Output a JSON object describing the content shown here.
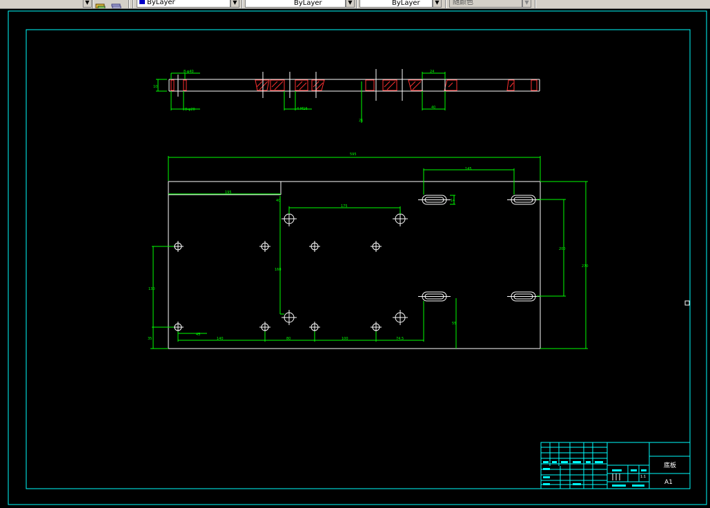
{
  "toolbar": {
    "layer_combo_1": "ByLayer",
    "layer_combo_2": "ByLayer",
    "layer_combo_3": "ByLayer",
    "plot_style": "随颜色",
    "colors": {
      "blue_swatch": "#0000c8",
      "face": "#d4d0c8"
    }
  },
  "drawing": {
    "colors": {
      "frame": "#00ffff",
      "geometry": "#ffffff",
      "dimension": "#00ff00",
      "hatch": "#ff0000"
    },
    "side_view_dims": {
      "top_left": "8-φ40",
      "bottom_left": "8-φ20",
      "left_height": "10",
      "center": "4-M16",
      "vertical": "21",
      "top_right": "24",
      "bottom_right": "40"
    },
    "plan_view_dims": {
      "overall_width": "595",
      "left_top": "195",
      "small_vertical": "40",
      "hole_spacing_top": "175",
      "slot_spacing_top": "145",
      "slot_width": "14",
      "right_vertical": "200",
      "overall_height": "270",
      "left_vertical": "130",
      "middle_vertical": "160",
      "slot_drop": "55",
      "bottom_left_small": "45",
      "bottom_140": "140",
      "bottom_80": "80",
      "bottom_100": "100",
      "bottom_74": "74.5",
      "bottom_left_height": "35"
    },
    "title_block": {
      "name": "底板",
      "sheet": "A1",
      "scale": "1:1"
    }
  }
}
